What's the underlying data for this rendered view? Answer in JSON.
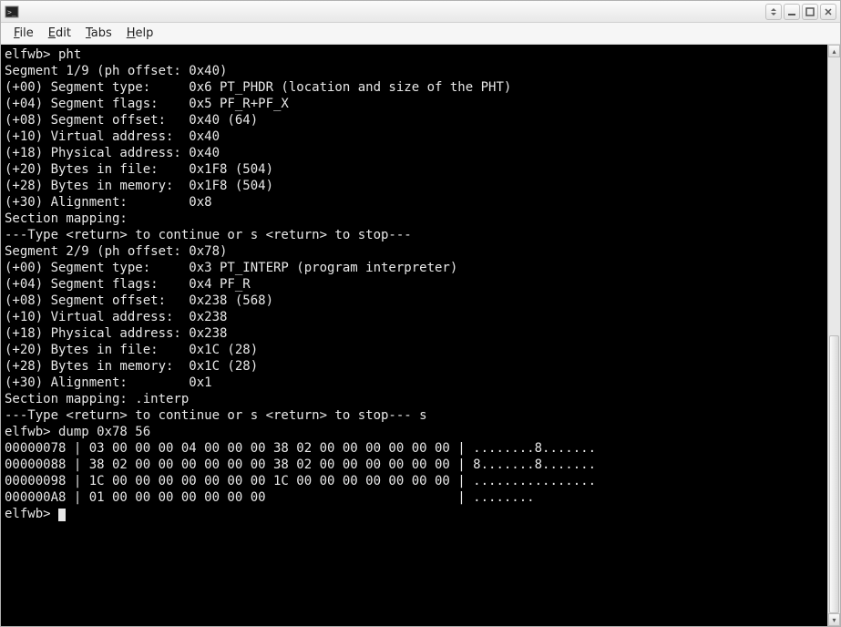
{
  "menubar": {
    "file": "File",
    "edit": "Edit",
    "tabs": "Tabs",
    "help": "Help"
  },
  "terminal": {
    "lines": [
      "elfwb> pht",
      "Segment 1/9 (ph offset: 0x40)",
      "",
      "(+00) Segment type:     0x6 PT_PHDR (location and size of the PHT)",
      "(+04) Segment flags:    0x5 PF_R+PF_X",
      "(+08) Segment offset:   0x40 (64)",
      "(+10) Virtual address:  0x40",
      "(+18) Physical address: 0x40",
      "(+20) Bytes in file:    0x1F8 (504)",
      "(+28) Bytes in memory:  0x1F8 (504)",
      "(+30) Alignment:        0x8",
      "",
      "Section mapping:",
      "",
      "---Type <return> to continue or s <return> to stop---",
      "Segment 2/9 (ph offset: 0x78)",
      "",
      "(+00) Segment type:     0x3 PT_INTERP (program interpreter)",
      "(+04) Segment flags:    0x4 PF_R",
      "(+08) Segment offset:   0x238 (568)",
      "(+10) Virtual address:  0x238",
      "(+18) Physical address: 0x238",
      "(+20) Bytes in file:    0x1C (28)",
      "(+28) Bytes in memory:  0x1C (28)",
      "(+30) Alignment:        0x1",
      "",
      "Section mapping: .interp",
      "",
      "---Type <return> to continue or s <return> to stop--- s",
      "elfwb> dump 0x78 56",
      "00000078 | 03 00 00 00 04 00 00 00 38 02 00 00 00 00 00 00 | ........8.......",
      "00000088 | 38 02 00 00 00 00 00 00 38 02 00 00 00 00 00 00 | 8.......8.......",
      "00000098 | 1C 00 00 00 00 00 00 00 1C 00 00 00 00 00 00 00 | ................",
      "000000A8 | 01 00 00 00 00 00 00 00                         | ........",
      "elfwb> "
    ]
  }
}
